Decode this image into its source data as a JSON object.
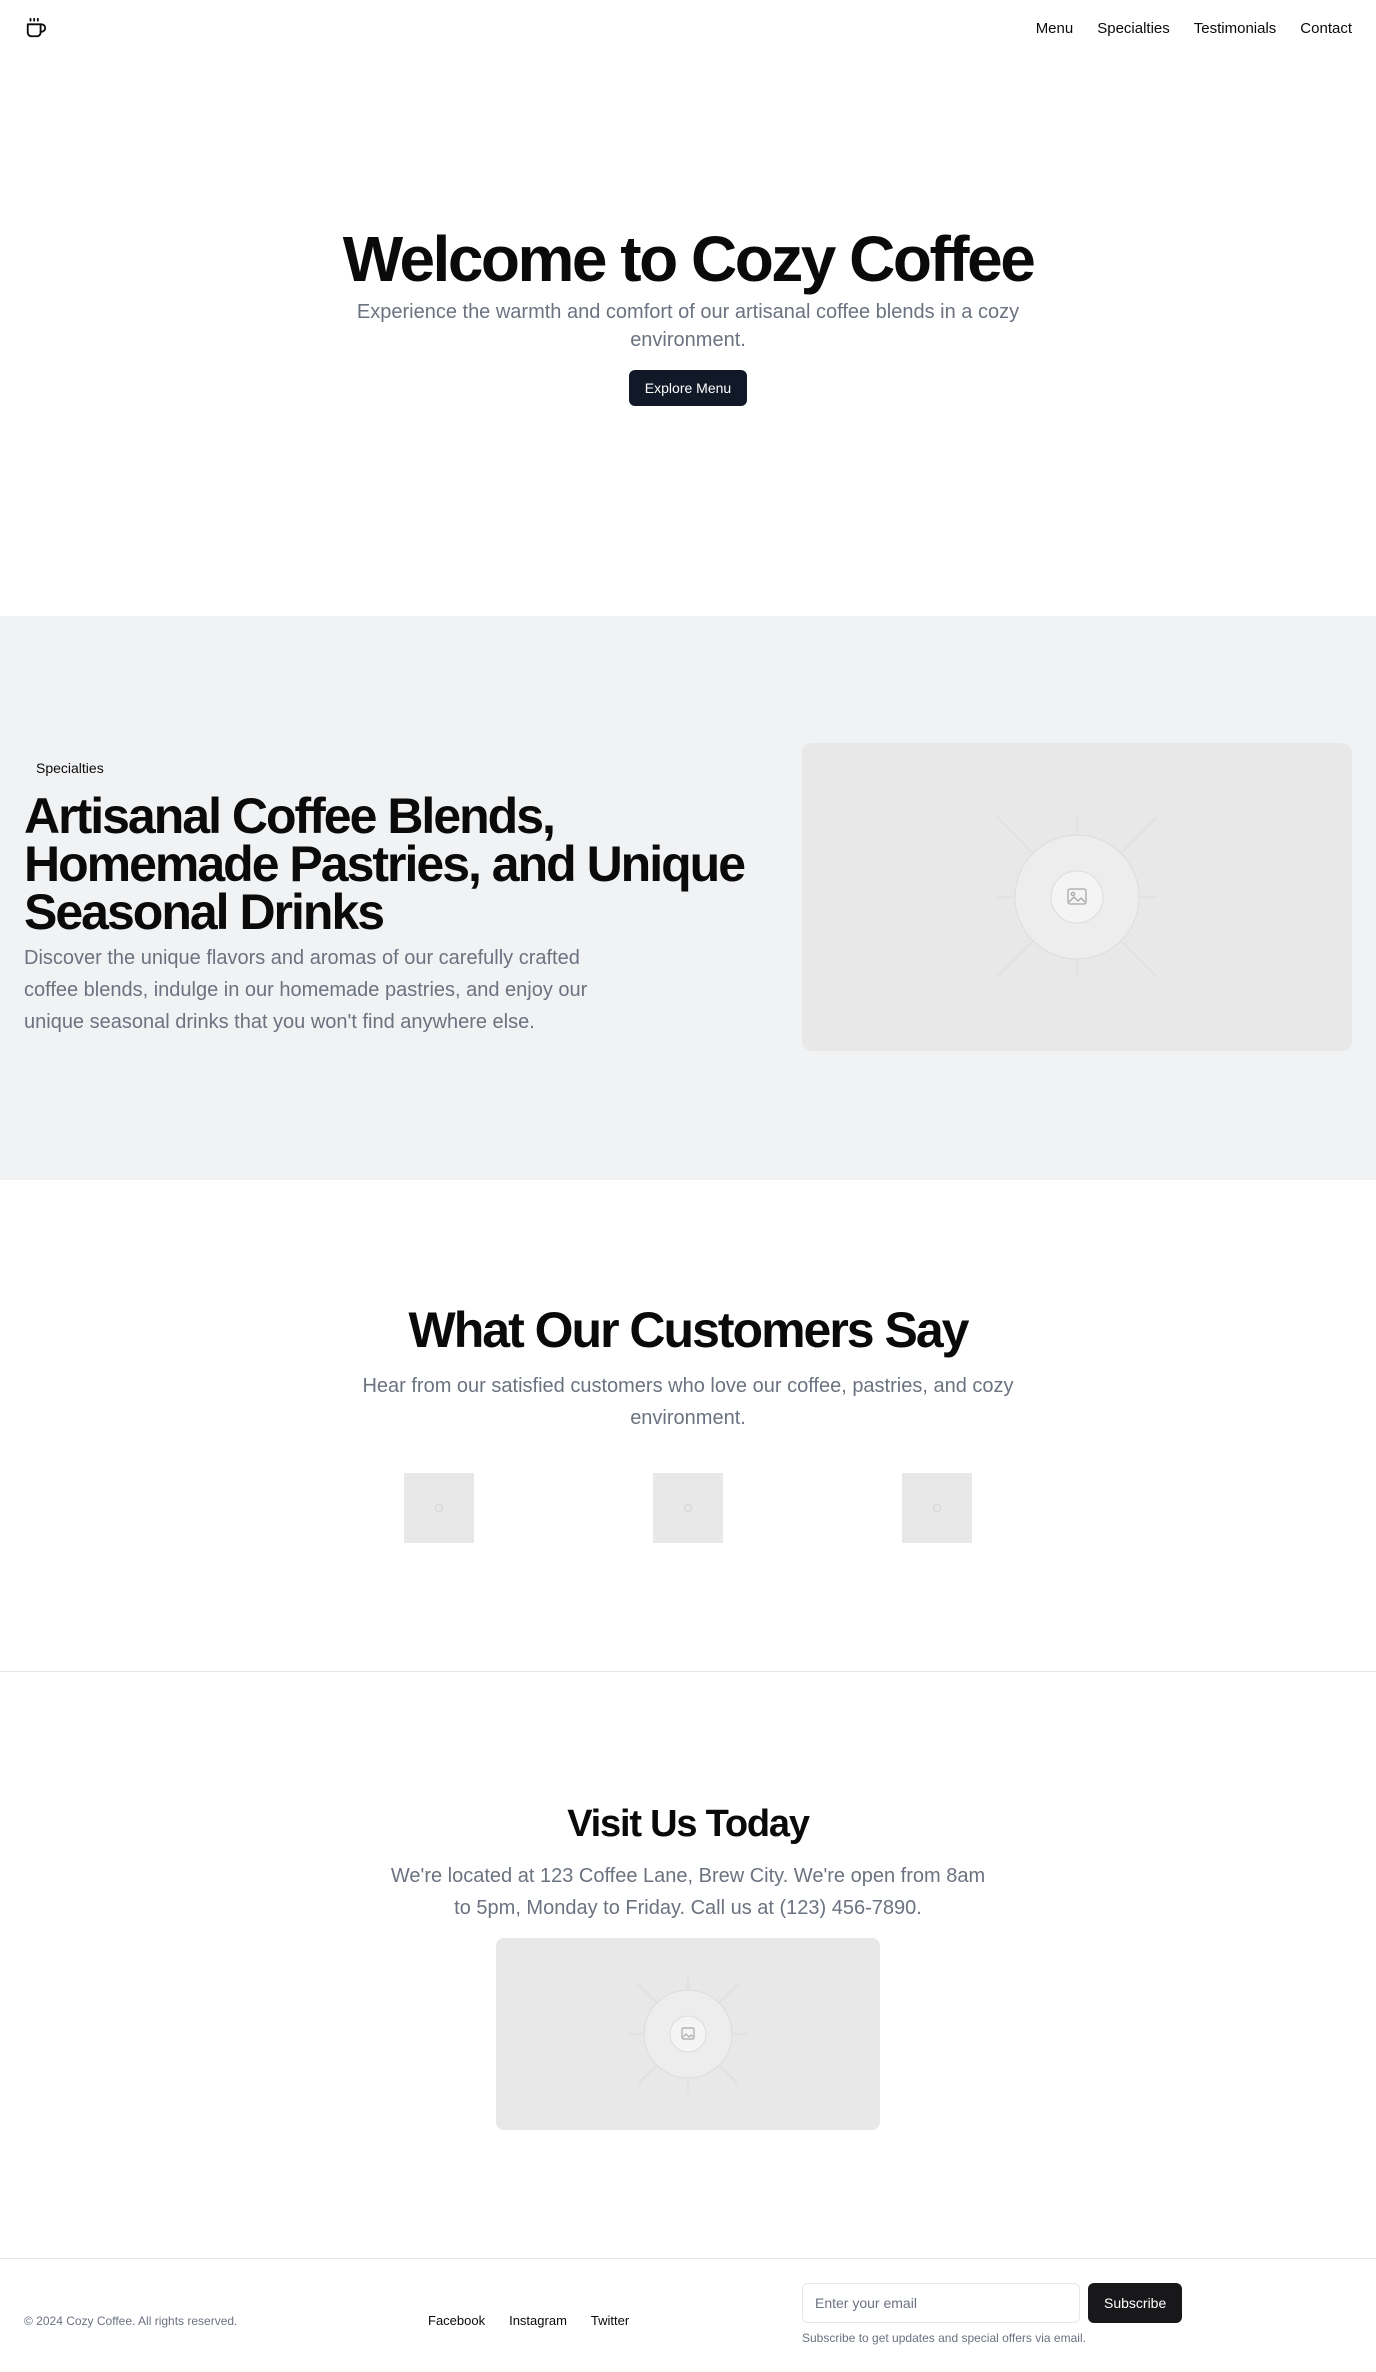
{
  "header": {
    "logo_icon": "coffee-cup-icon",
    "nav": [
      "Menu",
      "Specialties",
      "Testimonials",
      "Contact"
    ]
  },
  "hero": {
    "title": "Welcome to Cozy Coffee",
    "subtitle": "Experience the warmth and comfort of our artisanal coffee blends in a cozy environment.",
    "cta_label": "Explore Menu"
  },
  "specialties": {
    "badge": "Specialties",
    "title": "Artisanal Coffee Blends, Homemade Pastries, and Unique Seasonal Drinks",
    "description": "Discover the unique flavors and aromas of our carefully crafted coffee blends, indulge in our homemade pastries, and enjoy our unique seasonal drinks that you won't find anywhere else.",
    "image_icon": "image-placeholder-icon"
  },
  "testimonials": {
    "title": "What Our Customers Say",
    "subtitle": "Hear from our satisfied customers who love our coffee, pastries, and cozy environment.",
    "avatars": [
      "avatar-placeholder-icon",
      "avatar-placeholder-icon",
      "avatar-placeholder-icon"
    ]
  },
  "visit": {
    "title": "Visit Us Today",
    "description": "We're located at 123 Coffee Lane, Brew City. We're open from 8am to 5pm, Monday to Friday. Call us at (123) 456-7890.",
    "image_icon": "image-placeholder-icon"
  },
  "footer": {
    "copyright": "© 2024 Cozy Coffee. All rights reserved.",
    "links": [
      "Facebook",
      "Instagram",
      "Twitter"
    ],
    "email_placeholder": "Enter your email",
    "email_value": "",
    "subscribe_label": "Subscribe",
    "note": "Subscribe to get updates and special offers via email."
  },
  "colors": {
    "primary_button": "#111827",
    "muted_text": "#6b7280",
    "section_bg": "#f1f2f4",
    "placeholder_bg": "#e8e8e8"
  }
}
